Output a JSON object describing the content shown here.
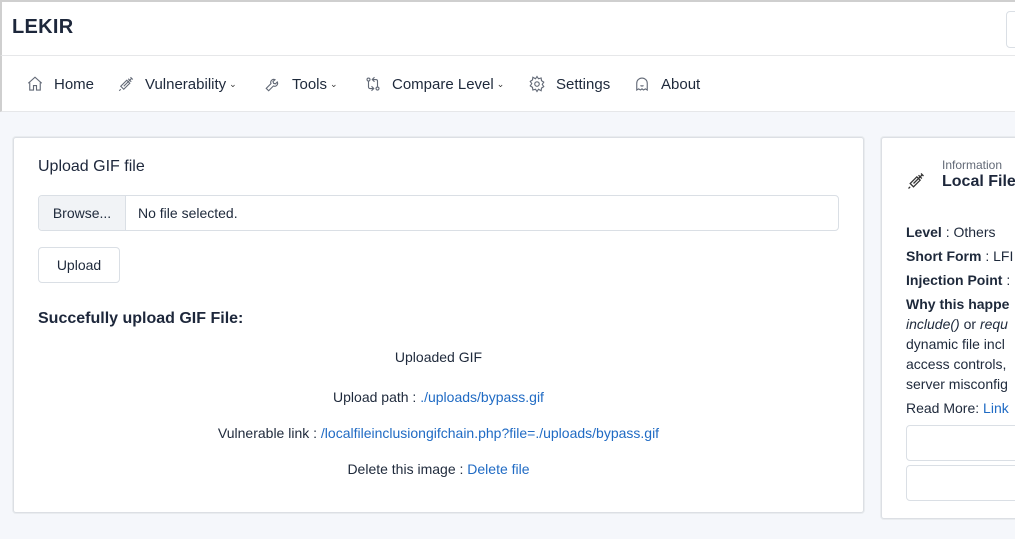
{
  "app": {
    "brand": "LEKIR"
  },
  "nav": {
    "home": "Home",
    "vulnerability": "Vulnerability",
    "tools": "Tools",
    "compare_level": "Compare Level",
    "settings": "Settings",
    "about": "About"
  },
  "upload": {
    "title": "Upload GIF file",
    "browse_label": "Browse...",
    "file_status": "No file selected.",
    "upload_button": "Upload",
    "success_heading": "Succefully upload GIF File:",
    "uploaded_label": "Uploaded GIF",
    "path_label": "Upload path : ",
    "path_value": "./uploads/bypass.gif",
    "vuln_label": "Vulnerable link : ",
    "vuln_value": "/localfileinclusiongifchain.php?file=./uploads/bypass.gif",
    "delete_label": "Delete this image : ",
    "delete_value": "Delete file"
  },
  "info": {
    "subtitle": "Information",
    "title": "Local File",
    "level_label": "Level",
    "level_value": " : Others",
    "short_form_label": "Short Form",
    "short_form_value": " : LFI",
    "injection_label": "Injection Point",
    "injection_value": " :",
    "why_label": "Why this happe",
    "why_line1_a": "include()",
    "why_line1_b": " or ",
    "why_line1_c": "requ",
    "why_line2": "dynamic file incl",
    "why_line3": "access controls,",
    "why_line4": "server misconfig",
    "read_more_label": "Read More: ",
    "read_more_link": "Link"
  }
}
